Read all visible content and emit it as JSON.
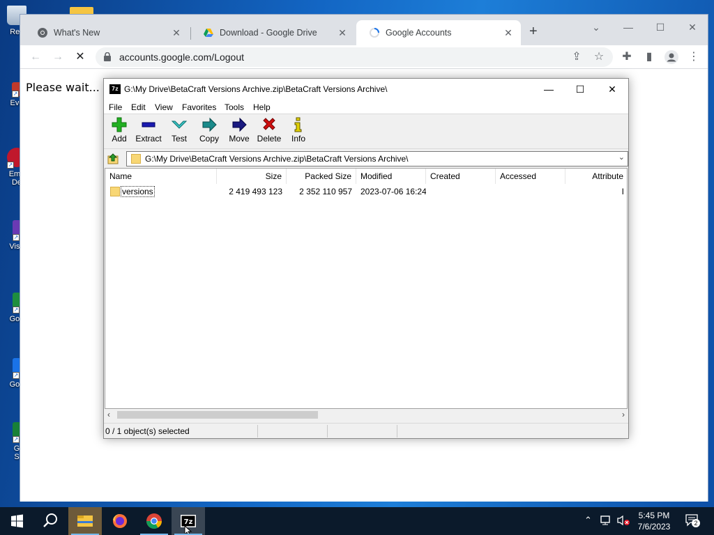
{
  "desktop": {
    "icons": [
      {
        "label": "Rec"
      },
      {
        "label": "Eve"
      },
      {
        "label": "Emb"
      },
      {
        "label": "De"
      },
      {
        "label": "Visu"
      },
      {
        "label": "Goo"
      },
      {
        "label": "Goo"
      },
      {
        "label": "G"
      },
      {
        "label": "S"
      }
    ]
  },
  "chrome": {
    "tabs": [
      {
        "title": "What's New",
        "icon": "chrome-icon"
      },
      {
        "title": "Download - Google Drive",
        "icon": "google-drive-icon"
      },
      {
        "title": "Google Accounts",
        "icon": "loading-spinner-icon"
      }
    ],
    "new_tab_symbol": "+",
    "address": "accounts.google.com/Logout",
    "page_text": "Please wait..."
  },
  "sevenzip": {
    "app_icon_text": "7z",
    "title": "G:\\My Drive\\BetaCraft Versions Archive.zip\\BetaCraft Versions Archive\\",
    "menu": [
      "File",
      "Edit",
      "View",
      "Favorites",
      "Tools",
      "Help"
    ],
    "toolbar": [
      {
        "label": "Add",
        "icon": "add-icon",
        "color": "#22b022"
      },
      {
        "label": "Extract",
        "icon": "extract-icon",
        "color": "#1a1ab0"
      },
      {
        "label": "Test",
        "icon": "test-icon",
        "color": "#3cc8c8"
      },
      {
        "label": "Copy",
        "icon": "copy-icon",
        "color": "#1a8a8a"
      },
      {
        "label": "Move",
        "icon": "move-icon",
        "color": "#1a1a80"
      },
      {
        "label": "Delete",
        "icon": "delete-icon",
        "color": "#d01010"
      },
      {
        "label": "Info",
        "icon": "info-icon",
        "color": "#e0d000"
      }
    ],
    "path": "G:\\My Drive\\BetaCraft Versions Archive.zip\\BetaCraft Versions Archive\\",
    "columns": [
      "Name",
      "Size",
      "Packed Size",
      "Modified",
      "Created",
      "Accessed",
      "Attribute"
    ],
    "rows": [
      {
        "name": "versions",
        "size": "2 419 493 123",
        "packed": "2 352 110 957",
        "modified": "2023-07-06 16:24",
        "created": "",
        "accessed": "",
        "attr": "I"
      }
    ],
    "status": "0 / 1 object(s) selected"
  },
  "taskbar": {
    "time": "5:45 PM",
    "date": "7/6/2023",
    "notification_count": "2"
  }
}
